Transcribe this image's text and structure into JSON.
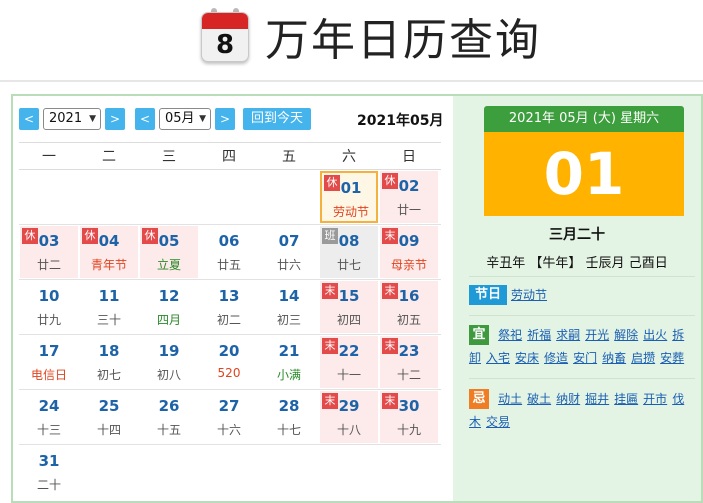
{
  "header": {
    "title": "万年日历查询",
    "logo_day": "8",
    "logo_icon": "calendar-icon"
  },
  "toolbar": {
    "prev_year": "<",
    "year": "2021",
    "next_year": ">",
    "prev_month": "<",
    "month": "05月",
    "next_month": ">",
    "today_label": "回到今天",
    "current": "2021年05月"
  },
  "weekdays": [
    "一",
    "二",
    "三",
    "四",
    "五",
    "六",
    "日"
  ],
  "weeks": [
    [
      null,
      null,
      null,
      null,
      null,
      {
        "day": "01",
        "sub": "劳动节",
        "tag": "休",
        "type": "rest",
        "subColor": "red",
        "today": true
      },
      {
        "day": "02",
        "sub": "廿一",
        "tag": "休",
        "type": "rest"
      }
    ],
    [
      {
        "day": "03",
        "sub": "廿二",
        "tag": "休",
        "type": "rest"
      },
      {
        "day": "04",
        "sub": "青年节",
        "tag": "休",
        "type": "rest",
        "subColor": "red"
      },
      {
        "day": "05",
        "sub": "立夏",
        "tag": "休",
        "type": "rest",
        "subColor": "green"
      },
      {
        "day": "06",
        "sub": "廿五"
      },
      {
        "day": "07",
        "sub": "廿六"
      },
      {
        "day": "08",
        "sub": "廿七",
        "tag": "班",
        "type": "work"
      },
      {
        "day": "09",
        "sub": "母亲节",
        "tag": "末",
        "type": "rest",
        "subColor": "red"
      }
    ],
    [
      {
        "day": "10",
        "sub": "廿九"
      },
      {
        "day": "11",
        "sub": "三十"
      },
      {
        "day": "12",
        "sub": "四月",
        "subColor": "green"
      },
      {
        "day": "13",
        "sub": "初二"
      },
      {
        "day": "14",
        "sub": "初三"
      },
      {
        "day": "15",
        "sub": "初四",
        "tag": "末",
        "type": "rest"
      },
      {
        "day": "16",
        "sub": "初五",
        "tag": "末",
        "type": "rest"
      }
    ],
    [
      {
        "day": "17",
        "sub": "电信日",
        "subColor": "red"
      },
      {
        "day": "18",
        "sub": "初七"
      },
      {
        "day": "19",
        "sub": "初八"
      },
      {
        "day": "20",
        "sub": "520",
        "subColor": "red"
      },
      {
        "day": "21",
        "sub": "小满",
        "subColor": "green"
      },
      {
        "day": "22",
        "sub": "十一",
        "tag": "末",
        "type": "rest"
      },
      {
        "day": "23",
        "sub": "十二",
        "tag": "末",
        "type": "rest"
      }
    ],
    [
      {
        "day": "24",
        "sub": "十三"
      },
      {
        "day": "25",
        "sub": "十四"
      },
      {
        "day": "26",
        "sub": "十五"
      },
      {
        "day": "27",
        "sub": "十六"
      },
      {
        "day": "28",
        "sub": "十七"
      },
      {
        "day": "29",
        "sub": "十八",
        "tag": "末",
        "type": "rest"
      },
      {
        "day": "30",
        "sub": "十九",
        "tag": "末",
        "type": "rest"
      }
    ],
    [
      {
        "day": "31",
        "sub": "二十"
      },
      null,
      null,
      null,
      null,
      null,
      null
    ]
  ],
  "detail": {
    "date_line": "2021年 05月 (大) 星期六",
    "big_day": "01",
    "lunar": "三月二十",
    "ganzhi": "辛丑年 【牛年】 壬辰月 己酉日",
    "festival_label": "节日",
    "festival": "劳动节",
    "yi_label": "宜",
    "yi": [
      "祭祀",
      "祈福",
      "求嗣",
      "开光",
      "解除",
      "出火",
      "拆卸",
      "入宅",
      "安床",
      "修造",
      "安门",
      "纳畜",
      "启攒",
      "安葬"
    ],
    "ji_label": "忌",
    "ji": [
      "动土",
      "破土",
      "纳财",
      "掘井",
      "挂匾",
      "开市",
      "伐木",
      "交易"
    ]
  },
  "colors": {
    "accent": "#45b4ec",
    "green": "#3d9e3d",
    "gold": "#ffb300",
    "rest": "#e34b4b"
  }
}
